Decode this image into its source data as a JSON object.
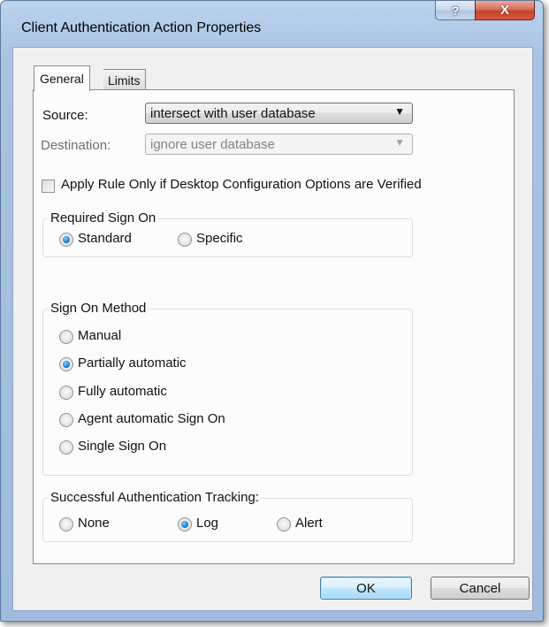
{
  "window": {
    "title": "Client Authentication Action Properties",
    "help_glyph": "?",
    "close_glyph": "X"
  },
  "tabs": [
    {
      "label": "General",
      "active": true
    },
    {
      "label": "Limits",
      "active": false
    }
  ],
  "source": {
    "label": "Source:",
    "value": "intersect with user database",
    "arrow": "▼"
  },
  "destination": {
    "label": "Destination:",
    "value": "ignore user database",
    "arrow": "▼",
    "enabled": false
  },
  "apply_rule": {
    "label": "Apply Rule Only if Desktop Configuration Options are Verified",
    "checked": false
  },
  "required_sign_on": {
    "legend": "Required Sign On",
    "options": [
      {
        "label": "Standard",
        "selected": true
      },
      {
        "label": "Specific",
        "selected": false
      }
    ]
  },
  "sign_on_method": {
    "legend": "Sign On Method",
    "options": [
      {
        "label": "Manual",
        "selected": false
      },
      {
        "label": "Partially automatic",
        "selected": true
      },
      {
        "label": "Fully automatic",
        "selected": false
      },
      {
        "label": "Agent automatic Sign On",
        "selected": false
      },
      {
        "label": "Single Sign On",
        "selected": false
      }
    ]
  },
  "tracking": {
    "legend": "Successful Authentication Tracking:",
    "options": [
      {
        "label": "None",
        "selected": false
      },
      {
        "label": "Log",
        "selected": true
      },
      {
        "label": "Alert",
        "selected": false
      }
    ]
  },
  "buttons": {
    "ok": "OK",
    "cancel": "Cancel"
  }
}
